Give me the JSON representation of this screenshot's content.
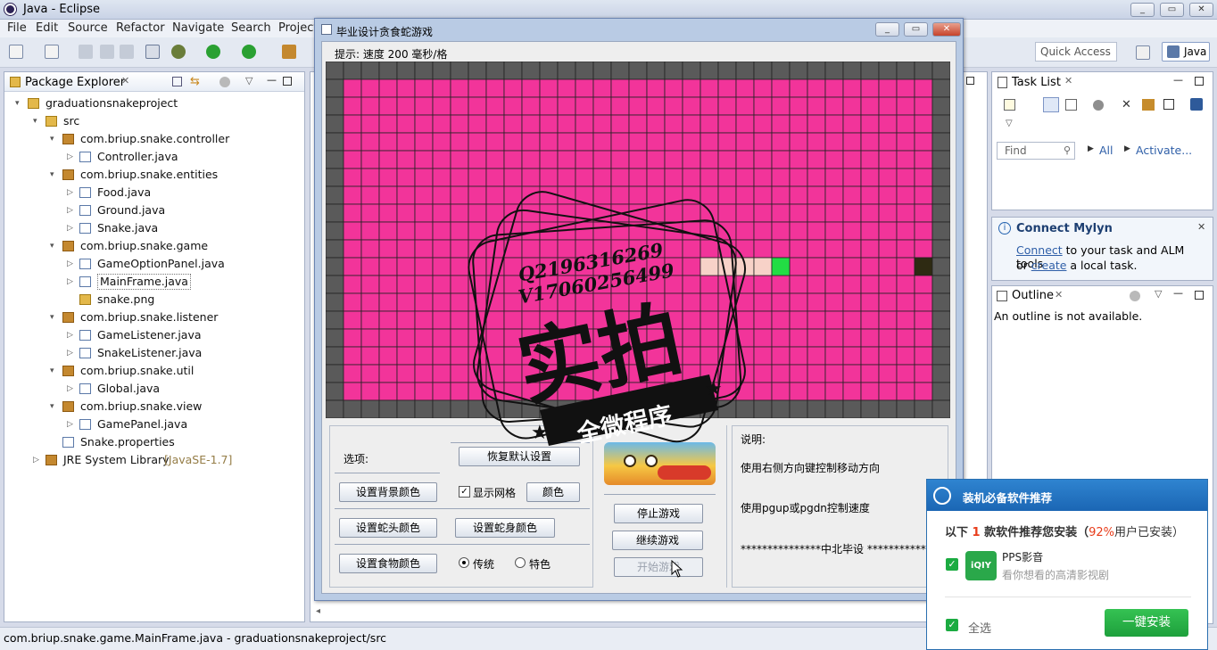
{
  "window": {
    "title": "Java - Eclipse"
  },
  "menu": [
    "File",
    "Edit",
    "Source",
    "Refactor",
    "Navigate",
    "Search",
    "Project"
  ],
  "toolbar": {
    "quick_access": "Quick Access",
    "perspective": "Java"
  },
  "package_explorer": {
    "title": "Package Explorer",
    "items": [
      {
        "label": "graduationsnakeproject",
        "type": "project",
        "level": 0,
        "arrow": "▾"
      },
      {
        "label": "src",
        "type": "folder",
        "level": 1,
        "arrow": "▾"
      },
      {
        "label": "com.briup.snake.controller",
        "type": "package",
        "level": 2,
        "arrow": "▾"
      },
      {
        "label": "Controller.java",
        "type": "java",
        "level": 3,
        "arrow": "▷"
      },
      {
        "label": "com.briup.snake.entities",
        "type": "package",
        "level": 2,
        "arrow": "▾"
      },
      {
        "label": "Food.java",
        "type": "java",
        "level": 3,
        "arrow": "▷"
      },
      {
        "label": "Ground.java",
        "type": "java",
        "level": 3,
        "arrow": "▷"
      },
      {
        "label": "Snake.java",
        "type": "java",
        "level": 3,
        "arrow": "▷"
      },
      {
        "label": "com.briup.snake.game",
        "type": "package",
        "level": 2,
        "arrow": "▾"
      },
      {
        "label": "GameOptionPanel.java",
        "type": "java",
        "level": 3,
        "arrow": "▷"
      },
      {
        "label": "MainFrame.java",
        "type": "java",
        "level": 3,
        "arrow": "▷",
        "selected": true
      },
      {
        "label": "snake.png",
        "type": "image",
        "level": 3,
        "arrow": ""
      },
      {
        "label": "com.briup.snake.listener",
        "type": "package",
        "level": 2,
        "arrow": "▾"
      },
      {
        "label": "GameListener.java",
        "type": "java",
        "level": 3,
        "arrow": "▷"
      },
      {
        "label": "SnakeListener.java",
        "type": "java",
        "level": 3,
        "arrow": "▷"
      },
      {
        "label": "com.briup.snake.util",
        "type": "package",
        "level": 2,
        "arrow": "▾"
      },
      {
        "label": "Global.java",
        "type": "java",
        "level": 3,
        "arrow": "▷"
      },
      {
        "label": "com.briup.snake.view",
        "type": "package",
        "level": 2,
        "arrow": "▾"
      },
      {
        "label": "GamePanel.java",
        "type": "java",
        "level": 3,
        "arrow": "▷"
      },
      {
        "label": "Snake.properties",
        "type": "file",
        "level": 2,
        "arrow": ""
      },
      {
        "label": "JRE System Library",
        "suffix": "[JavaSE-1.7]",
        "type": "library",
        "level": 1,
        "arrow": "▷"
      }
    ]
  },
  "task_list": {
    "title": "Task List",
    "find_placeholder": "Find",
    "all": "All",
    "activate": "Activate..."
  },
  "mylyn": {
    "title": "Connect Mylyn",
    "link1": "Connect",
    "text1": " to your task and ALM tools",
    "text2a": "or ",
    "link2": "create",
    "text2b": " a local task."
  },
  "outline": {
    "title": "Outline",
    "message": "An outline is not available."
  },
  "status": {
    "text": "com.briup.snake.game.MainFrame.java - graduationsnakeproject/src"
  },
  "game": {
    "title": "毕业设计贪食蛇游戏",
    "tip": "提示: 速度  200  毫秒/格",
    "board_color": "#f2349a",
    "wall_color": "#5a5a5a",
    "options_label": "选项:",
    "restore_defaults": "恢复默认设置",
    "bg_color_btn": "设置背景颜色",
    "show_grid": "显示网格",
    "grid_color_btn": "颜色",
    "head_color_btn": "设置蛇头颜色",
    "body_color_btn": "设置蛇身颜色",
    "food_color_btn": "设置食物颜色",
    "radio_traditional": "传统",
    "radio_special": "特色",
    "stop_btn": "停止游戏",
    "resume_btn": "继续游戏",
    "start_btn": "开始游戏",
    "desc_title": "说明:",
    "desc1": "使用右侧方向键控制移动方向",
    "desc2": "使用pgup或pgdn控制速度",
    "desc3": "***************中北毕设  *************"
  },
  "watermark": {
    "line1": "Q2196316269",
    "line2": "V17060256499",
    "big": "实拍",
    "ribbon": "全微程序"
  },
  "popup": {
    "title": "装机必备软件推荐",
    "line_pre": "以下 ",
    "count": "1",
    "line_mid": " 款软件推荐您安装（",
    "percent": "92%",
    "line_post": "用户已安装）",
    "app_name": "PPS影音",
    "app_desc": "看你想看的高清影视剧",
    "app_icon_text": "iQIY",
    "select_all": "全选",
    "install_btn": "一键安装"
  }
}
